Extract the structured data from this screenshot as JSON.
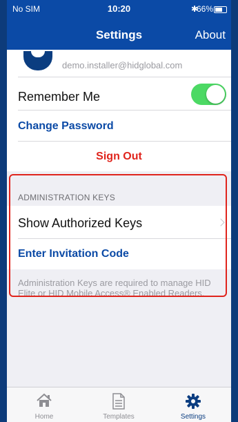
{
  "status_bar": {
    "carrier": "No SIM",
    "time": "10:20",
    "bluetooth": "✱",
    "battery": "66%"
  },
  "nav": {
    "title": "Settings",
    "right_button": "About"
  },
  "account": {
    "email": "demo.installer@hidglobal.com"
  },
  "remember_me": {
    "label": "Remember Me",
    "enabled": true
  },
  "change_password": "Change Password",
  "sign_out": "Sign Out",
  "admin_keys": {
    "header": "ADMINISTRATION KEYS",
    "show_keys": "Show Authorized Keys",
    "enter_code": "Enter Invitation Code",
    "footnote": "Administration Keys are required to manage HID Elite or HID Mobile Access® Enabled Readers."
  },
  "tabs": [
    {
      "label": "Home",
      "icon": "home-icon",
      "active": false
    },
    {
      "label": "Templates",
      "icon": "document-icon",
      "active": false
    },
    {
      "label": "Settings",
      "icon": "gear-icon",
      "active": true
    }
  ],
  "colors": {
    "brand_blue": "#0b4aa6",
    "toggle_on": "#4cd964",
    "destructive": "#e0241c",
    "highlight": "#e0241c"
  }
}
